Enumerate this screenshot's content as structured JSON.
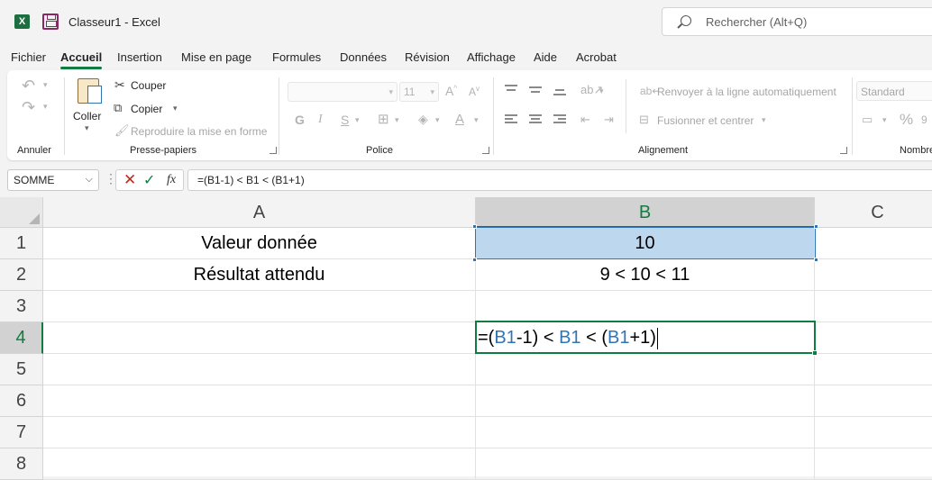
{
  "app": {
    "title": "Classeur1  -  Excel",
    "logo_letter": "X"
  },
  "search": {
    "placeholder": "Rechercher (Alt+Q)"
  },
  "menu": [
    "Fichier",
    "Accueil",
    "Insertion",
    "Mise en page",
    "Formules",
    "Données",
    "Révision",
    "Affichage",
    "Aide",
    "Acrobat"
  ],
  "active_menu": "Accueil",
  "ribbon": {
    "annuler": {
      "label": "Annuler"
    },
    "presse_papiers": {
      "label": "Presse-papiers",
      "coller": "Coller",
      "couper": "Couper",
      "copier": "Copier",
      "reproduire": "Reproduire la mise en forme"
    },
    "police": {
      "label": "Police",
      "font_size": "11"
    },
    "alignement": {
      "label": "Alignement",
      "renvoyer": "Renvoyer à la ligne automatiquement",
      "fusionner": "Fusionner et centrer"
    },
    "nombre": {
      "label": "Nombre",
      "format": "Standard",
      "percent": "%"
    }
  },
  "formula_bar": {
    "name_box": "SOMME",
    "fx": "fx",
    "formula": "=(B1-1) < B1 < (B1+1)"
  },
  "sheet": {
    "columns": [
      "A",
      "B",
      "C"
    ],
    "rows": [
      "1",
      "2",
      "3",
      "4",
      "5",
      "6",
      "7",
      "8"
    ],
    "cells": {
      "A1": "Valeur donnée",
      "B1": "10",
      "A2": "Résultat attendu",
      "B2": "9  < 10 < 11"
    },
    "editing": {
      "cell": "B4",
      "tokens": [
        {
          "text": "=(",
          "ref": false
        },
        {
          "text": "B1",
          "ref": true
        },
        {
          "text": "-1) < ",
          "ref": false
        },
        {
          "text": "B1",
          "ref": true
        },
        {
          "text": " < (",
          "ref": false
        },
        {
          "text": "B1",
          "ref": true
        },
        {
          "text": "+1)",
          "ref": false
        }
      ]
    }
  },
  "colors": {
    "accent": "#107c41",
    "ref_blue": "#2e75b6",
    "selection_fill": "#bdd7ee"
  }
}
